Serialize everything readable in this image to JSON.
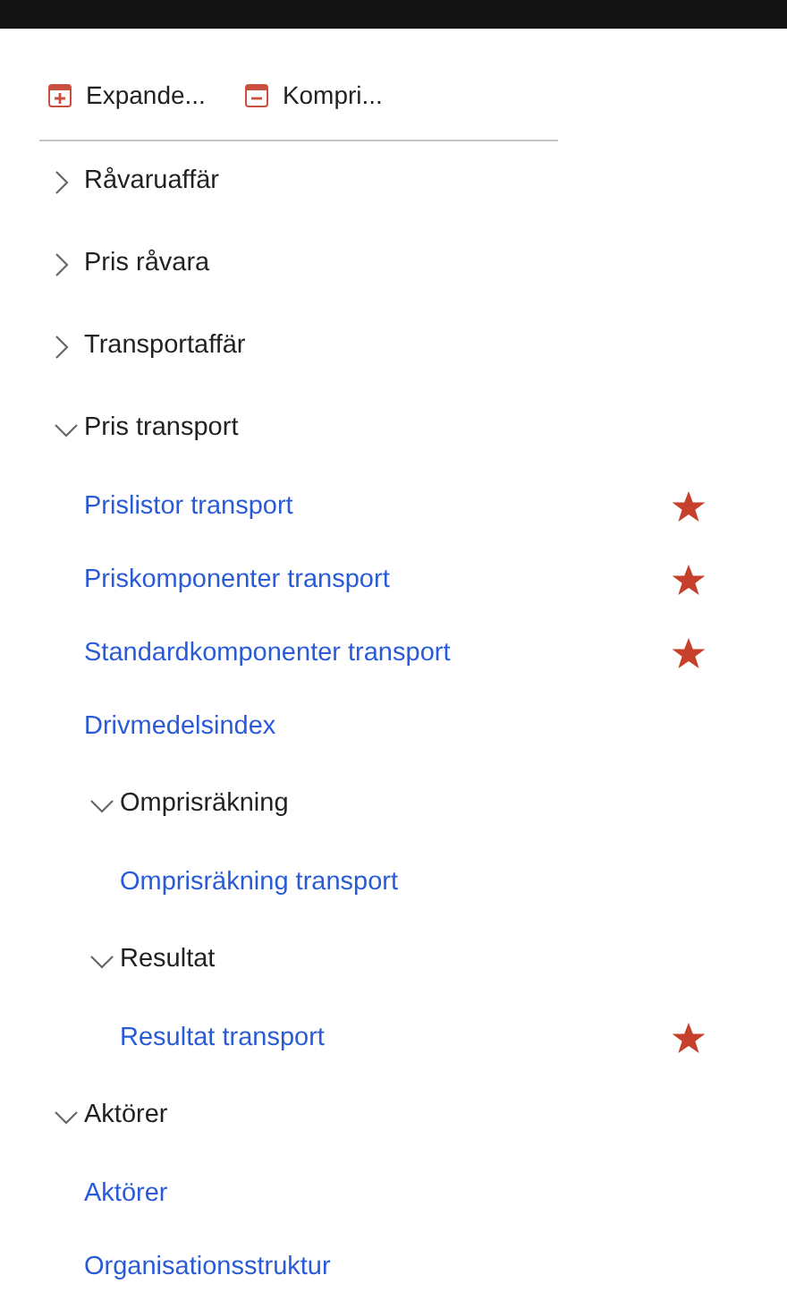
{
  "toolbar": [
    {
      "kind": "expand",
      "label": "Expande..."
    },
    {
      "kind": "collapse",
      "label": "Kompri..."
    }
  ],
  "tree": [
    {
      "kind": "group",
      "label": "Råvaruaffär",
      "expanded": false
    },
    {
      "kind": "group",
      "label": "Pris råvara",
      "expanded": false
    },
    {
      "kind": "group",
      "label": "Transportaffär",
      "expanded": false
    },
    {
      "kind": "group",
      "label": "Pris transport",
      "expanded": true,
      "children": [
        {
          "kind": "link",
          "label": "Prislistor transport",
          "favorite": true
        },
        {
          "kind": "link",
          "label": "Priskomponenter transport",
          "favorite": true
        },
        {
          "kind": "link",
          "label": "Standardkomponenter transport",
          "favorite": true
        },
        {
          "kind": "link",
          "label": "Drivmedelsindex",
          "favorite": false
        },
        {
          "kind": "group",
          "label": "Omprisräkning",
          "expanded": true,
          "children": [
            {
              "kind": "link",
              "label": "Omprisräkning transport",
              "favorite": false
            }
          ]
        },
        {
          "kind": "group",
          "label": "Resultat",
          "expanded": true,
          "children": [
            {
              "kind": "link",
              "label": "Resultat transport",
              "favorite": true
            }
          ]
        }
      ]
    },
    {
      "kind": "group",
      "label": "Aktörer",
      "expanded": true,
      "children": [
        {
          "kind": "link",
          "label": "Aktörer",
          "favorite": false
        },
        {
          "kind": "link",
          "label": "Organisationsstruktur",
          "favorite": false
        }
      ]
    }
  ]
}
